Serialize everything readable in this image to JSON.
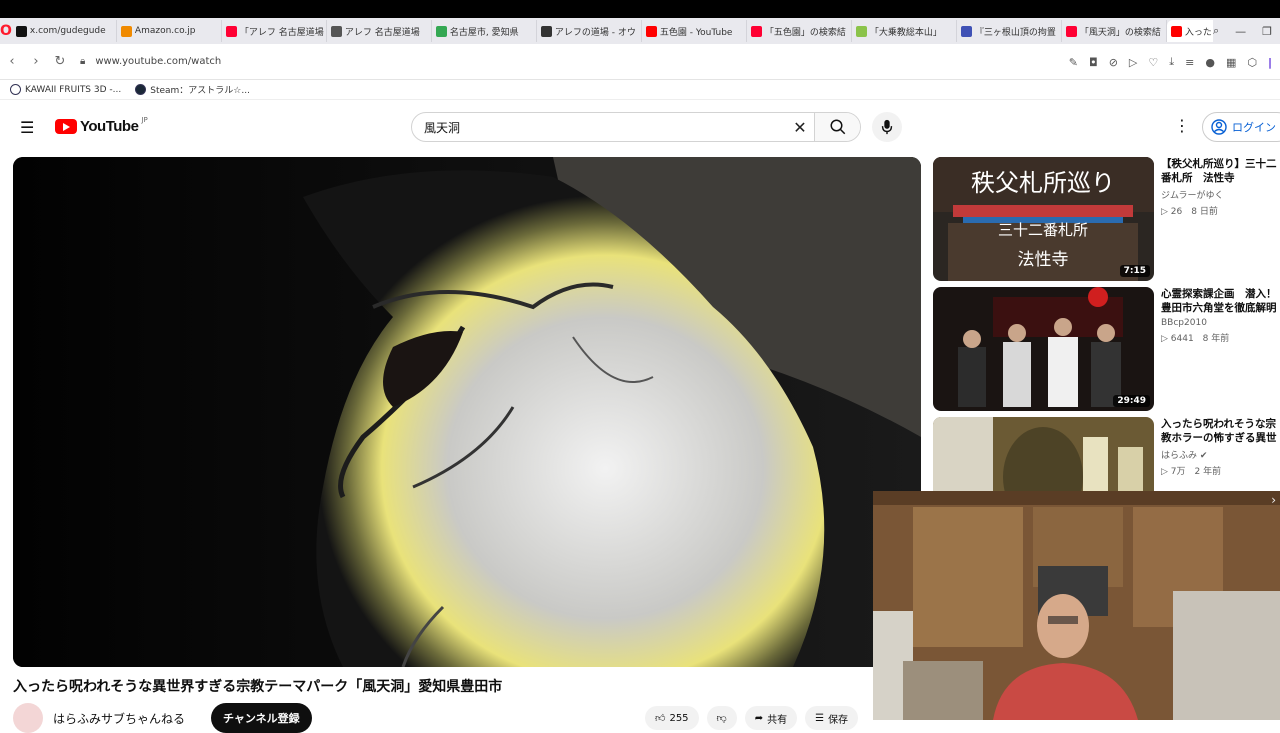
{
  "browser": {
    "tabs": [
      {
        "label": "x.com/gudegude",
        "icon": "x-logo-icon",
        "color": "#111111"
      },
      {
        "label": "Amazon.co.jp",
        "icon": "amazon-icon",
        "color": "#f08a00"
      },
      {
        "label": "「アレフ 名古屋道場",
        "icon": "yahoo-icon",
        "color": "#ff0033"
      },
      {
        "label": "アレフ 名古屋道場",
        "icon": "pin-icon",
        "color": "#555555"
      },
      {
        "label": "名古屋市, 愛知県",
        "icon": "maps-icon",
        "color": "#34a853"
      },
      {
        "label": "アレフの道場 - オウ",
        "icon": "doc-icon",
        "color": "#333333"
      },
      {
        "label": "五色園 - YouTube",
        "icon": "youtube-icon",
        "color": "#ff0000"
      },
      {
        "label": "「五色園」の検索結",
        "icon": "yahoo-icon",
        "color": "#ff0033"
      },
      {
        "label": "「大乗教総本山」",
        "icon": "site-icon",
        "color": "#8bc34a"
      },
      {
        "label": "『三ヶ根山頂の拘置",
        "icon": "site-icon",
        "color": "#3f51b5"
      },
      {
        "label": "「風天洞」の検索結",
        "icon": "yahoo-icon",
        "color": "#ff0033"
      },
      {
        "label": "入ったら呪われそうな異世",
        "icon": "youtube-icon",
        "color": "#ff0000",
        "active": true
      }
    ],
    "url": "www.youtube.com/watch",
    "bookmarks": [
      {
        "label": "KAWAII FRUITS 3D -..."
      },
      {
        "label": "Steam：アストラル☆..."
      }
    ]
  },
  "youtube": {
    "logo_text": "YouTube",
    "region": "JP",
    "search_value": "風天洞",
    "login_label": "ログイン",
    "video": {
      "title": "入ったら呪われそうな異世界すぎる宗教テーマパーク「風天洞」愛知県豊田市",
      "channel": "はらふみサブちゃんねる",
      "subscribe_label": "チャンネル登録",
      "like_count": "255",
      "share_label": "共有",
      "save_label": "保存"
    },
    "recommendations": [
      {
        "title": "【秩父札所巡り】三十二番札所　法性寺",
        "channel": "ジムラーがゆく",
        "meta": "▷ 26　8 日前",
        "duration": "7:15",
        "thumb_text_top": "秩父札所巡り",
        "thumb_text_mid": "三十二番札所",
        "thumb_text_bot": "法性寺"
      },
      {
        "title": "心霊探索課企画　潜入！豊田市六角堂を徹底解明",
        "channel": "BBcp2010",
        "meta": "▷ 6441　8 年前",
        "duration": "29:49"
      },
      {
        "title": "入ったら呪われそうな宗教ホラーの怖すぎる異世界B級スポット「風天洞」愛...",
        "channel": "はらふみ",
        "meta": "▷ 7万　2 年前",
        "duration": ""
      }
    ]
  }
}
